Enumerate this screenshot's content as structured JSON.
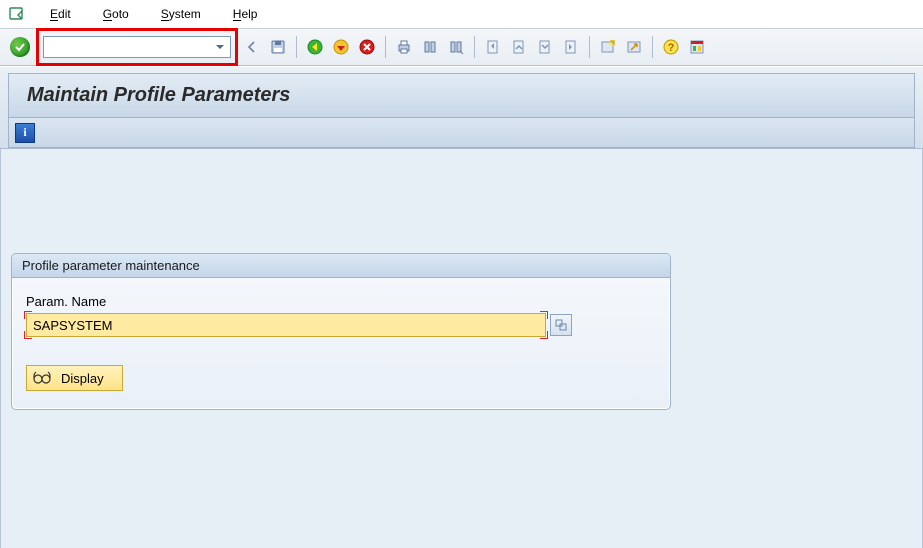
{
  "menubar": {
    "items": [
      {
        "u": "E",
        "rest": "dit"
      },
      {
        "u": "G",
        "rest": "oto"
      },
      {
        "u": "S",
        "rest": "ystem"
      },
      {
        "u": "H",
        "rest": "elp"
      }
    ]
  },
  "command_field": {
    "value": ""
  },
  "page_title": "Maintain Profile Parameters",
  "info_button": "i",
  "group": {
    "title": "Profile parameter maintenance",
    "param_label": "Param. Name",
    "param_value": "SAPSYSTEM",
    "display_label": "Display"
  }
}
